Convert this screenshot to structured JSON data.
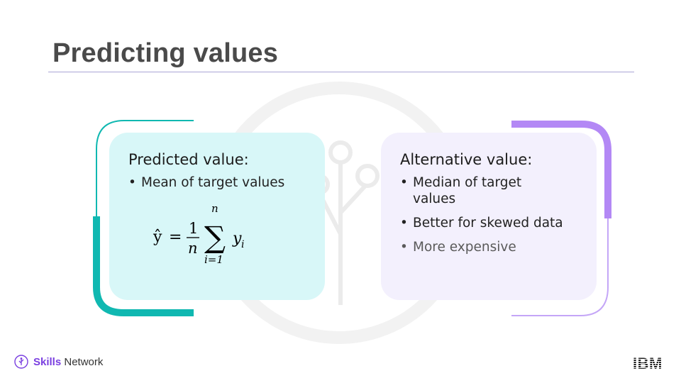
{
  "slide": {
    "title": "Predicting values"
  },
  "left_card": {
    "heading": "Predicted value:",
    "bullets": [
      "Mean of target values"
    ],
    "formula": {
      "lhs": "ŷ",
      "equals": "=",
      "numerator": "1",
      "denominator": "n",
      "sum_symbol": "∑",
      "upper_limit": "n",
      "lower_limit": "i=1",
      "term": "y",
      "term_subscript": "i"
    }
  },
  "right_card": {
    "heading": "Alternative value:",
    "bullets": [
      "Median of target values",
      "Better for skewed data",
      "More expensive"
    ]
  },
  "footer": {
    "brand_bold": "Skills",
    "brand_light": "Network",
    "company_logo_text": "IBM"
  },
  "colors": {
    "teal": "#10b8b1",
    "purple": "#b388f5",
    "left_card_bg": "#d8f7f8",
    "right_card_bg": "#f3f0fd"
  }
}
